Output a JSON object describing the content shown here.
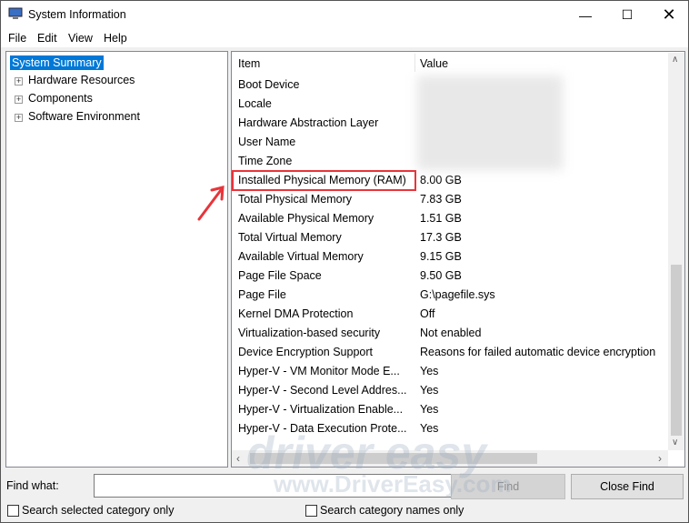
{
  "window": {
    "title": "System Information",
    "icon": "system-information-icon",
    "controls": [
      "minimize",
      "maximize",
      "close"
    ]
  },
  "menu": [
    "File",
    "Edit",
    "View",
    "Help"
  ],
  "tree": [
    {
      "label": "System Summary",
      "selected": true
    },
    {
      "label": "Hardware Resources"
    },
    {
      "label": "Components"
    },
    {
      "label": "Software Environment"
    }
  ],
  "table": {
    "headers": [
      "Item",
      "Value"
    ],
    "rows": [
      {
        "item": "Boot Device",
        "value": ""
      },
      {
        "item": "Locale",
        "value": ""
      },
      {
        "item": "Hardware Abstraction Layer",
        "value": ""
      },
      {
        "item": "User Name",
        "value": ""
      },
      {
        "item": "Time Zone",
        "value": ""
      },
      {
        "item": "Installed Physical Memory (RAM)",
        "value": "8.00 GB",
        "highlighted": true
      },
      {
        "item": "Total Physical Memory",
        "value": "7.83 GB"
      },
      {
        "item": "Available Physical Memory",
        "value": "1.51 GB"
      },
      {
        "item": "Total Virtual Memory",
        "value": "17.3 GB"
      },
      {
        "item": "Available Virtual Memory",
        "value": "9.15 GB"
      },
      {
        "item": "Page File Space",
        "value": "9.50 GB"
      },
      {
        "item": "Page File",
        "value": "G:\\pagefile.sys"
      },
      {
        "item": "Kernel DMA Protection",
        "value": "Off"
      },
      {
        "item": "Virtualization-based security",
        "value": "Not enabled"
      },
      {
        "item": "Device Encryption Support",
        "value": "Reasons for failed automatic device encryption"
      },
      {
        "item": "Hyper-V - VM Monitor Mode E...",
        "value": "Yes"
      },
      {
        "item": "Hyper-V - Second Level Addres...",
        "value": "Yes"
      },
      {
        "item": "Hyper-V - Virtualization Enable...",
        "value": "Yes"
      },
      {
        "item": "Hyper-V - Data Execution Prote...",
        "value": "Yes"
      }
    ]
  },
  "find": {
    "label": "Find what:",
    "value": "",
    "find_button": "Find",
    "close_button": "Close Find",
    "check_selected": "Search selected category only",
    "check_names": "Search category names only"
  },
  "watermark": {
    "line1": "driver easy",
    "line2": "www.DriverEasy.com"
  },
  "colors": {
    "selection": "#0078d7",
    "highlight": "#e8343a"
  }
}
